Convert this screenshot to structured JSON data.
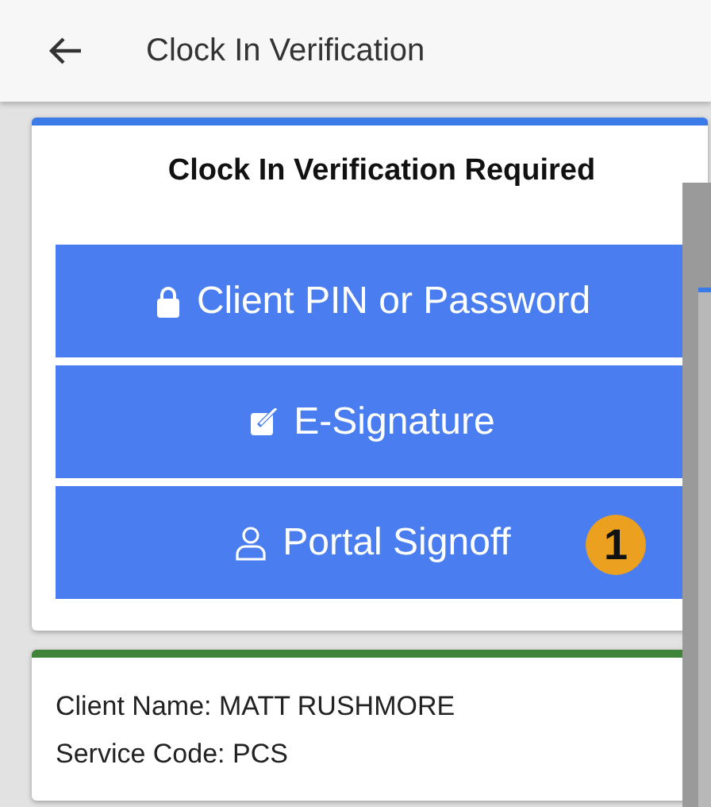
{
  "app_bar": {
    "title": "Clock In Verification"
  },
  "verification_card": {
    "heading": "Clock In Verification Required",
    "options": [
      {
        "kind": "lock",
        "label": "Client PIN or Password"
      },
      {
        "kind": "signature",
        "label": "E-Signature"
      },
      {
        "kind": "person",
        "label": "Portal Signoff",
        "badge": "1"
      }
    ]
  },
  "client_card": {
    "lines": [
      "Client Name: MATT RUSHMORE",
      "Service Code: PCS"
    ]
  }
}
